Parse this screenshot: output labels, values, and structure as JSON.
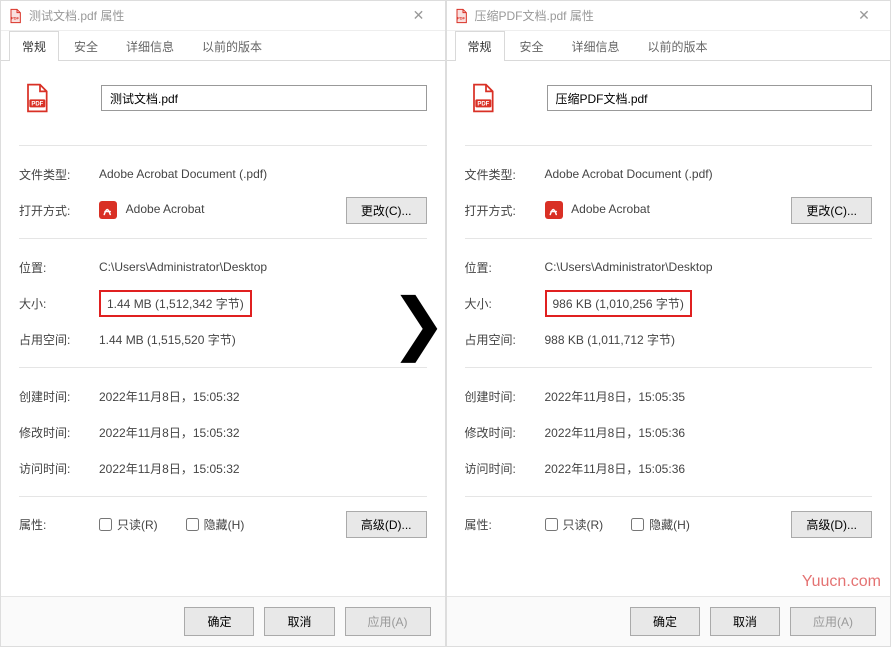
{
  "left": {
    "title": "测试文档.pdf 属性",
    "filename": "测试文档.pdf",
    "tabs": {
      "general": "常规",
      "security": "安全",
      "details": "详细信息",
      "versions": "以前的版本"
    },
    "labels": {
      "filetype": "文件类型:",
      "openwith": "打开方式:",
      "location": "位置:",
      "size": "大小:",
      "ondisk": "占用空间:",
      "created": "创建时间:",
      "modified": "修改时间:",
      "accessed": "访问时间:",
      "attrs": "属性:",
      "readonly": "只读(R)",
      "hidden": "隐藏(H)"
    },
    "values": {
      "filetype": "Adobe Acrobat Document (.pdf)",
      "openwith": "Adobe Acrobat",
      "location": "C:\\Users\\Administrator\\Desktop",
      "size": "1.44 MB (1,512,342 字节)",
      "ondisk": "1.44 MB (1,515,520 字节)",
      "created": "2022年11月8日，15:05:32",
      "modified": "2022年11月8日，15:05:32",
      "accessed": "2022年11月8日，15:05:32"
    },
    "buttons": {
      "change": "更改(C)...",
      "advanced": "高级(D)...",
      "ok": "确定",
      "cancel": "取消",
      "apply": "应用(A)"
    }
  },
  "right": {
    "title": "压缩PDF文档.pdf 属性",
    "filename": "压缩PDF文档.pdf",
    "tabs": {
      "general": "常规",
      "security": "安全",
      "details": "详细信息",
      "versions": "以前的版本"
    },
    "labels": {
      "filetype": "文件类型:",
      "openwith": "打开方式:",
      "location": "位置:",
      "size": "大小:",
      "ondisk": "占用空间:",
      "created": "创建时间:",
      "modified": "修改时间:",
      "accessed": "访问时间:",
      "attrs": "属性:",
      "readonly": "只读(R)",
      "hidden": "隐藏(H)"
    },
    "values": {
      "filetype": "Adobe Acrobat Document (.pdf)",
      "openwith": "Adobe Acrobat",
      "location": "C:\\Users\\Administrator\\Desktop",
      "size": "986 KB (1,010,256 字节)",
      "ondisk": "988 KB (1,011,712 字节)",
      "created": "2022年11月8日，15:05:35",
      "modified": "2022年11月8日，15:05:36",
      "accessed": "2022年11月8日，15:05:36"
    },
    "buttons": {
      "change": "更改(C)...",
      "advanced": "高级(D)...",
      "ok": "确定",
      "cancel": "取消",
      "apply": "应用(A)"
    }
  },
  "watermark": "Yuucn.com"
}
